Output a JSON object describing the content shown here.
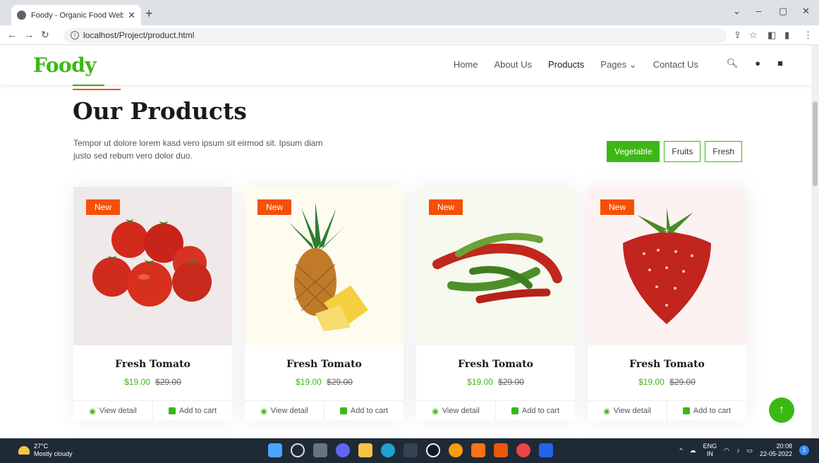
{
  "browser": {
    "tab_title": "Foody - Organic Food Website T",
    "url": "localhost/Project/product.html"
  },
  "site": {
    "logo": "Foody",
    "nav": [
      "Home",
      "About Us",
      "Products",
      "Pages",
      "Contact Us"
    ],
    "active_nav": "Products"
  },
  "section": {
    "title": "Our Products",
    "description": "Tempor ut dolore lorem kasd vero ipsum sit eirmod sit. Ipsum diam justo sed rebum vero dolor duo.",
    "filters": [
      "Vegetable",
      "Fruits",
      "Fresh"
    ],
    "active_filter": "Vegetable"
  },
  "products": [
    {
      "badge": "New",
      "name": "Fresh Tomato",
      "price": "$19.00",
      "old_price": "$29.00",
      "view": "View detail",
      "cart": "Add to cart",
      "image": "tomato",
      "bg": "#efe9ea"
    },
    {
      "badge": "New",
      "name": "Fresh Tomato",
      "price": "$19.00",
      "old_price": "$29.00",
      "view": "View detail",
      "cart": "Add to cart",
      "image": "pineapple",
      "bg": "#fdfcef"
    },
    {
      "badge": "New",
      "name": "Fresh Tomato",
      "price": "$19.00",
      "old_price": "$29.00",
      "view": "View detail",
      "cart": "Add to cart",
      "image": "chili",
      "bg": "#f6f9ef"
    },
    {
      "badge": "New",
      "name": "Fresh Tomato",
      "price": "$19.00",
      "old_price": "$29.00",
      "view": "View detail",
      "cart": "Add to cart",
      "image": "strawberry",
      "bg": "#fdf2f2"
    }
  ],
  "taskbar": {
    "temp": "27°C",
    "weather": "Mostly cloudy",
    "lang": "ENG",
    "region": "IN",
    "time": "20:08",
    "date": "22-05-2022",
    "notifications": "1"
  },
  "colors": {
    "primary": "#3cb815",
    "secondary": "#f65005"
  }
}
